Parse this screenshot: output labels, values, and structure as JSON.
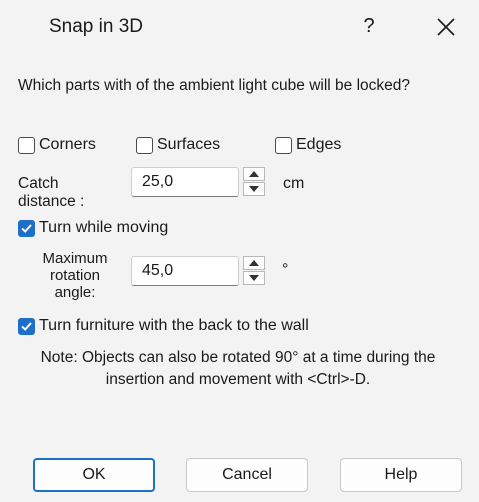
{
  "window": {
    "title": "Snap in 3D",
    "help_glyph": "?"
  },
  "question": "Which parts with of the ambient light cube will be locked?",
  "snap_targets": {
    "corners": {
      "label": "Corners",
      "checked": false
    },
    "surfaces": {
      "label": "Surfaces",
      "checked": false
    },
    "edges": {
      "label": "Edges",
      "checked": false
    }
  },
  "catch_distance": {
    "label": "Catch distance :",
    "value": "25,0",
    "unit": "cm"
  },
  "turn_while_moving": {
    "label": "Turn while moving",
    "checked": true
  },
  "max_rotation": {
    "label": "Maximum rotation angle:",
    "value": "45,0",
    "unit": "°"
  },
  "turn_furniture": {
    "label": "Turn furniture with the back to the wall",
    "checked": true
  },
  "note": "Note: Objects can also be rotated 90° at a time during the insertion and movement with <Ctrl>-D.",
  "buttons": {
    "ok": "OK",
    "cancel": "Cancel",
    "help": "Help"
  },
  "colors": {
    "accent": "#1e6fc9",
    "window_bg": "#f3f3f3"
  },
  "icons": {
    "help": "question-mark-icon",
    "close": "close-icon",
    "check": "checkmark-icon",
    "spin_up": "triangle-up-icon",
    "spin_down": "triangle-down-icon"
  }
}
